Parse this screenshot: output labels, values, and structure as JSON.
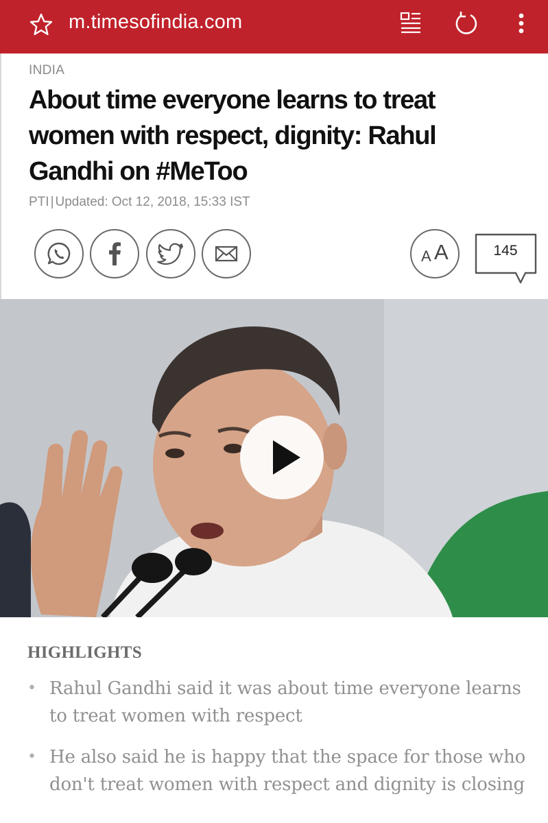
{
  "browser": {
    "url": "m.timesofindia.com",
    "icons": [
      "star-icon",
      "reader-mode-icon",
      "reload-icon",
      "overflow-menu-icon"
    ],
    "bar_color": "#c0222b"
  },
  "article": {
    "category": "INDIA",
    "headline": "About time everyone learns to treat women with respect, dignity: Rahul Gandhi on #MeToo",
    "source": "PTI",
    "separator": "|",
    "updated": "Updated: Oct 12, 2018, 15:33 IST",
    "share_icons": [
      "whatsapp-icon",
      "facebook-icon",
      "twitter-icon",
      "email-icon"
    ],
    "font_size_label_small": "A",
    "font_size_label_large": "A",
    "comment_count": "145"
  },
  "video": {
    "icon": "play-icon"
  },
  "highlights": {
    "title": "HIGHLIGHTS",
    "items": [
      "Rahul Gandhi said it was about time everyone learns to treat women with respect",
      "He also said he is happy that the space for those who don't treat women with respect and dignity is closing"
    ]
  }
}
